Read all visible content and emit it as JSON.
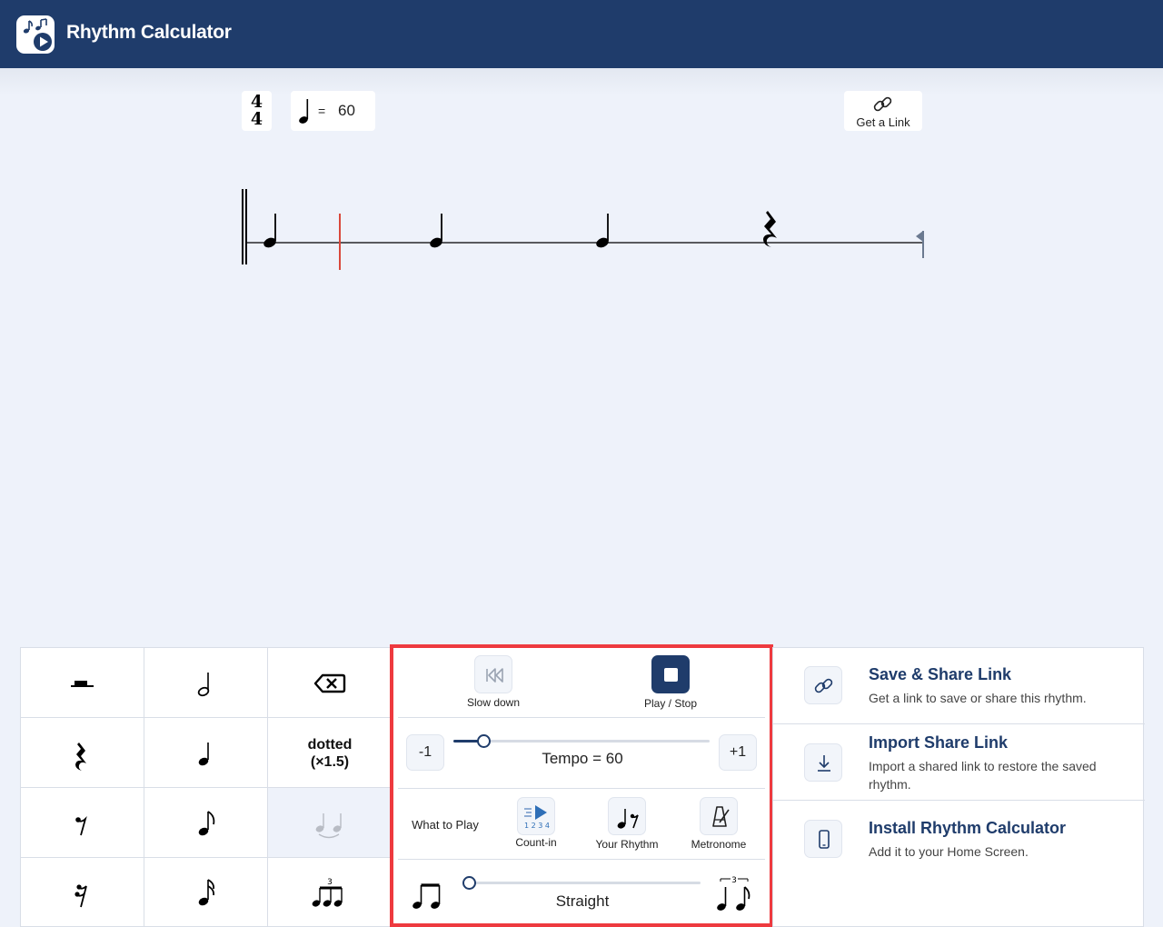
{
  "app": {
    "title": "Rhythm Calculator"
  },
  "toolbar": {
    "time_signature": {
      "top": "4",
      "bottom": "4"
    },
    "tempo": {
      "equals": "=",
      "value": "60"
    },
    "get_link_label": "Get a Link"
  },
  "palette": {
    "dotted_label_line1": "dotted",
    "dotted_label_line2": "(×1.5)",
    "items": [
      {
        "row": 1,
        "col": 1,
        "icon": "whole-rest-icon"
      },
      {
        "row": 1,
        "col": 2,
        "icon": "half-note-icon"
      },
      {
        "row": 1,
        "col": 3,
        "icon": "backspace-icon"
      },
      {
        "row": 2,
        "col": 1,
        "icon": "quarter-rest-icon"
      },
      {
        "row": 2,
        "col": 2,
        "icon": "quarter-note-icon"
      },
      {
        "row": 2,
        "col": 3,
        "icon": "dotted-toggle"
      },
      {
        "row": 3,
        "col": 1,
        "icon": "eighth-rest-icon"
      },
      {
        "row": 3,
        "col": 2,
        "icon": "eighth-note-icon"
      },
      {
        "row": 3,
        "col": 3,
        "icon": "tie-icon",
        "state": "disabled"
      },
      {
        "row": 4,
        "col": 1,
        "icon": "sixteenth-rest-icon"
      },
      {
        "row": 4,
        "col": 2,
        "icon": "sixteenth-note-icon"
      },
      {
        "row": 4,
        "col": 3,
        "icon": "triplet-icon"
      }
    ]
  },
  "controls": {
    "slow_down_label": "Slow down",
    "play_stop_label": "Play / Stop",
    "minus_label": "-1",
    "plus_label": "+1",
    "tempo_label": "Tempo = 60",
    "tempo_slider_value": 60,
    "what_to_play_label": "What to Play",
    "count_in_label": "Count-in",
    "count_in_digits": "1 2 3 4",
    "your_rhythm_label": "Your Rhythm",
    "metronome_label": "Metronome",
    "swing_label": "Straight",
    "swing_slider_value": 0,
    "triplet_number": "3"
  },
  "side": {
    "items": [
      {
        "title": "Save & Share Link",
        "desc": "Get a link to save or share this rhythm.",
        "icon": "link-icon"
      },
      {
        "title": "Import Share Link",
        "desc": "Import a shared link to restore the saved rhythm.",
        "icon": "download-icon"
      },
      {
        "title": "Install Rhythm Calculator",
        "desc": "Add it to your Home Screen.",
        "icon": "phone-icon"
      }
    ]
  },
  "colors": {
    "header_bg": "#1f3c6b",
    "page_bg": "#eef2fa",
    "playhead": "#d9483b",
    "highlight_border": "#ee3a3f"
  }
}
